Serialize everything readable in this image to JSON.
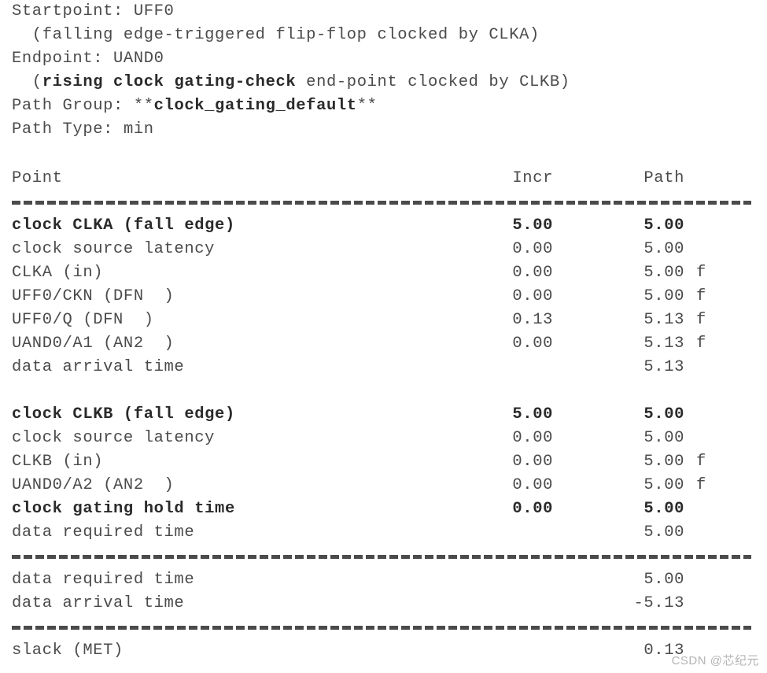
{
  "report": {
    "header": {
      "startpoint_label": "Startpoint: ",
      "startpoint_value": "UFF0",
      "startpoint_detail": "  (falling edge-triggered flip-flop clocked by CLKA)",
      "endpoint_label": "Endpoint: ",
      "endpoint_value": "UAND0",
      "endpoint_detail_pre": "  (",
      "endpoint_detail_bold": "rising clock gating-check",
      "endpoint_detail_post": " end-point clocked by CLKB)",
      "path_group_label": "Path Group: ",
      "path_group_marker_open": "**",
      "path_group_value": "clock_gating_default",
      "path_group_marker_close": "**",
      "path_type_label": "Path Type: ",
      "path_type_value": "min"
    },
    "columns": {
      "point": "Point",
      "incr": "Incr",
      "path": "Path"
    },
    "rows": [
      {
        "point": "clock CLKA (fall edge)",
        "incr": "5.00",
        "path": "5.00",
        "edge": "",
        "bold": true
      },
      {
        "point": "clock source latency",
        "incr": "0.00",
        "path": "5.00",
        "edge": "",
        "bold": false
      },
      {
        "point": "CLKA (in)",
        "incr": "0.00",
        "path": "5.00",
        "edge": "f",
        "bold": false
      },
      {
        "point": "UFF0/CKN (DFN  )",
        "incr": "0.00",
        "path": "5.00",
        "edge": "f",
        "bold": false
      },
      {
        "point": "UFF0/Q (DFN  )",
        "incr": "0.13",
        "path": "5.13",
        "edge": "f",
        "bold": false
      },
      {
        "point": "UAND0/A1 (AN2  )",
        "incr": "0.00",
        "path": "5.13",
        "edge": "f",
        "bold": false
      },
      {
        "point": "data arrival time",
        "incr": "",
        "path": "5.13",
        "edge": "",
        "bold": false
      },
      {
        "point": "",
        "incr": "",
        "path": "",
        "edge": "",
        "bold": false
      },
      {
        "point": "clock CLKB (fall edge)",
        "incr": "5.00",
        "path": "5.00",
        "edge": "",
        "bold": true
      },
      {
        "point": "clock source latency",
        "incr": "0.00",
        "path": "5.00",
        "edge": "",
        "bold": false
      },
      {
        "point": "CLKB (in)",
        "incr": "0.00",
        "path": "5.00",
        "edge": "f",
        "bold": false
      },
      {
        "point": "UAND0/A2 (AN2  )",
        "incr": "0.00",
        "path": "5.00",
        "edge": "f",
        "bold": false
      },
      {
        "point": "clock gating hold time",
        "incr": "0.00",
        "path": "5.00",
        "edge": "",
        "bold": true
      },
      {
        "point": "data required time",
        "incr": "",
        "path": "5.00",
        "edge": "",
        "bold": false
      }
    ],
    "summary_rows": [
      {
        "point": "data required time",
        "path": "5.00",
        "bold": false
      },
      {
        "point": "data arrival time",
        "path": "-5.13",
        "bold": false
      }
    ],
    "slack_row": {
      "point": "slack (MET)",
      "path": "0.13",
      "bold": false
    },
    "separator_char": "-"
  },
  "watermark": {
    "text": "CSDN @芯纪元"
  },
  "colors": {
    "text": "#4b4b4b",
    "bold_text": "#2a2a2a",
    "background": "#ffffff",
    "watermark": "#b4b4b4"
  },
  "chart_data": {
    "type": "table",
    "title": "Static Timing Analysis Path Report (clock gating hold check)",
    "columns": [
      "Point",
      "Incr",
      "Path"
    ],
    "rows": [
      [
        "clock CLKA (fall edge)",
        5.0,
        5.0
      ],
      [
        "clock source latency",
        0.0,
        5.0
      ],
      [
        "CLKA (in)",
        0.0,
        5.0
      ],
      [
        "UFF0/CKN (DFN  )",
        0.0,
        5.0
      ],
      [
        "UFF0/Q (DFN  )",
        0.13,
        5.13
      ],
      [
        "UAND0/A1 (AN2  )",
        0.0,
        5.13
      ],
      [
        "data arrival time",
        null,
        5.13
      ],
      [
        "clock CLKB (fall edge)",
        5.0,
        5.0
      ],
      [
        "clock source latency",
        0.0,
        5.0
      ],
      [
        "CLKB (in)",
        0.0,
        5.0
      ],
      [
        "UAND0/A2 (AN2  )",
        0.0,
        5.0
      ],
      [
        "clock gating hold time",
        0.0,
        5.0
      ],
      [
        "data required time",
        null,
        5.0
      ],
      [
        "data required time",
        null,
        5.0
      ],
      [
        "data arrival time",
        null,
        -5.13
      ],
      [
        "slack (MET)",
        null,
        0.13
      ]
    ]
  }
}
